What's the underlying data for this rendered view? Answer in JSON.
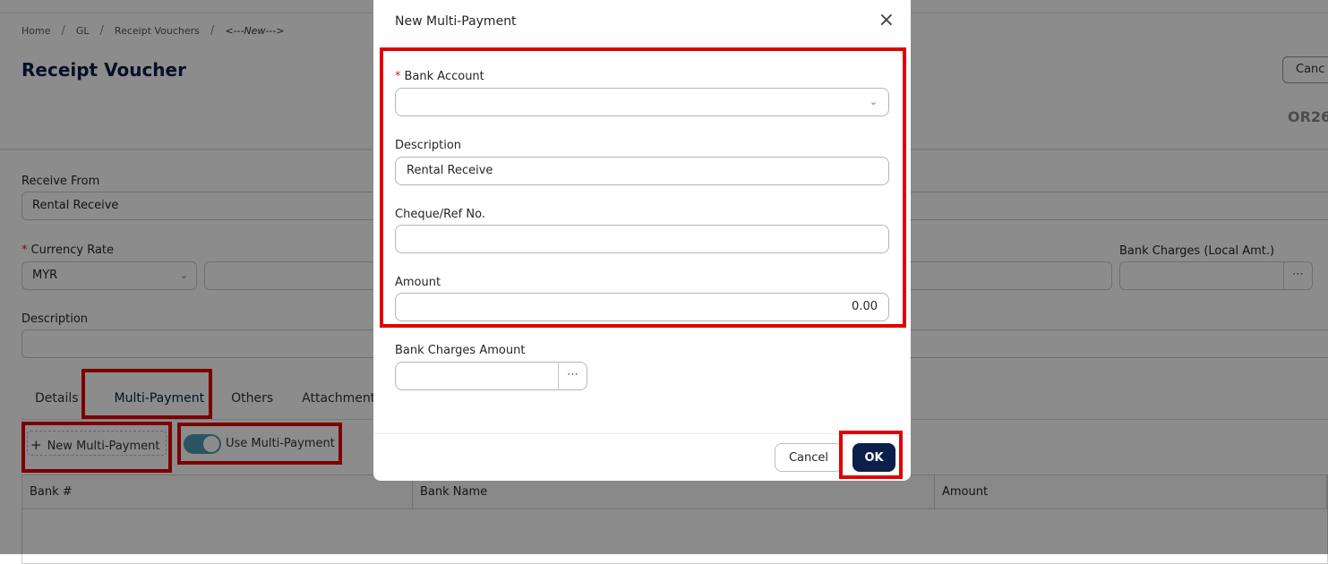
{
  "breadcrumb": [
    "Home",
    "GL",
    "Receipt Vouchers",
    "<---New--->"
  ],
  "page": {
    "title": "Receipt Voucher",
    "cancel_label": "Canc",
    "doc_no": "OR26"
  },
  "form": {
    "receive_from_label": "Receive From",
    "receive_from_value": "Rental Receive",
    "currency_rate_label": "Currency Rate",
    "currency_value": "MYR",
    "bank_charges_label": "Bank Charges (Local Amt.)",
    "description_label": "Description"
  },
  "tabs": [
    "Details",
    "Multi-Payment",
    "Others",
    "Attachments"
  ],
  "multi_payment": {
    "new_button_label": "New Multi-Payment",
    "toggle_label": "Use Multi-Payment",
    "toggle_on": true,
    "columns": [
      "Bank #",
      "Bank Name",
      "Amount"
    ]
  },
  "modal": {
    "title": "New Multi-Payment",
    "bank_account_label": "Bank Account",
    "bank_account_value": "",
    "description_label": "Description",
    "description_value": "Rental Receive",
    "cheque_label": "Cheque/Ref No.",
    "cheque_value": "",
    "amount_label": "Amount",
    "amount_value": "0.00",
    "bank_charges_label": "Bank Charges Amount",
    "bank_charges_value": "",
    "cancel_label": "Cancel",
    "ok_label": "OK"
  },
  "colors": {
    "accent": "#0c1e4a",
    "toggle": "#4f9ab5",
    "highlight": "#e00000",
    "required": "#e11d1d"
  }
}
